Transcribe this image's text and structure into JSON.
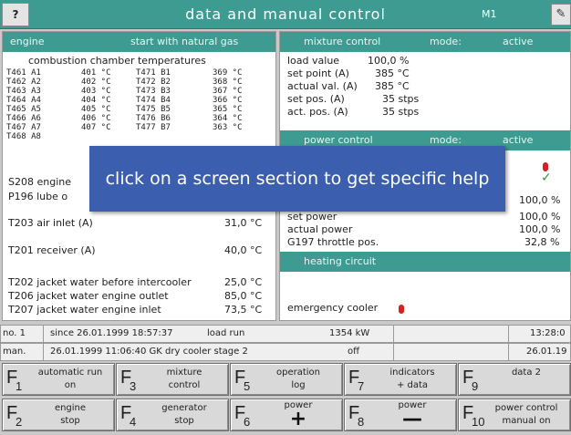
{
  "titlebar": {
    "help": "?",
    "title": "data and manual control",
    "screen_code": "M1",
    "edit_icon": "edit-icon"
  },
  "engine": {
    "header_left": "engine",
    "header_right": "start with natural gas",
    "combustion_title": "combustion chamber temperatures",
    "temps": [
      {
        "tag": "T461 A1",
        "val": "401 °C",
        "tag2": "T471 B1",
        "val2": "369 °C"
      },
      {
        "tag": "T462 A2",
        "val": "402 °C",
        "tag2": "T472 B2",
        "val2": "368 °C"
      },
      {
        "tag": "T463 A3",
        "val": "403 °C",
        "tag2": "T473 B3",
        "val2": "367 °C"
      },
      {
        "tag": "T464 A4",
        "val": "404 °C",
        "tag2": "T474 B4",
        "val2": "366 °C"
      },
      {
        "tag": "T465 A5",
        "val": "405 °C",
        "tag2": "T475 B5",
        "val2": "365 °C"
      },
      {
        "tag": "T466 A6",
        "val": "406 °C",
        "tag2": "T476 B6",
        "val2": "364 °C"
      },
      {
        "tag": "T467 A7",
        "val": "407 °C",
        "tag2": "T477 B7",
        "val2": "363 °C"
      },
      {
        "tag": "T468 A8",
        "val": "",
        "tag2": "",
        "val2": ""
      }
    ],
    "s208": "S208 engine",
    "p196": "P196 lube o",
    "t203_label": "T203 air inlet (A)",
    "t203_val": "31,0 °C",
    "t201_label": "T201 receiver (A)",
    "t201_val": "40,0 °C",
    "t202_label": "T202 jacket water before intercooler",
    "t202_val": "25,0 °C",
    "t206_label": "T206 jacket water engine outlet",
    "t206_val": "85,0 °C",
    "t207_label": "T207 jacket water engine inlet",
    "t207_val": "73,5 °C"
  },
  "mixture": {
    "header": "mixture control",
    "mode_label": "mode:",
    "mode_value": "active",
    "rows": [
      {
        "label": "load value",
        "value": "100,0 %"
      },
      {
        "label": "set point (A)",
        "value": "385 °C"
      },
      {
        "label": "actual val. (A)",
        "value": "385 °C"
      },
      {
        "label": "set pos. (A)",
        "value": "35 stps"
      },
      {
        "label": "act. pos. (A)",
        "value": "35 stps"
      }
    ]
  },
  "power": {
    "header": "power control",
    "mode_label": "mode:",
    "mode_value": "active",
    "rows": [
      {
        "label": "",
        "value": "100,0 %"
      },
      {
        "label": "set power",
        "value": "100,0 %"
      },
      {
        "label": "actual power",
        "value": "100,0 %"
      },
      {
        "label": "G197 throttle pos.",
        "value": "32,8 %"
      }
    ]
  },
  "heating": {
    "header": "heating circuit",
    "emergency_label": "emergency cooler"
  },
  "help_overlay": {
    "text": "click on a screen section to get specific help"
  },
  "status": {
    "row1": {
      "no": "no. 1",
      "since": "since 26.01.1999  18:57:37",
      "state": "load run",
      "power": "1354 kW",
      "time": "13:28:0"
    },
    "row2": {
      "man": "man.",
      "event": "26.01.1999 11:06:40 GK dry cooler stage 2",
      "state": "off",
      "date": "26.01.19"
    }
  },
  "fkeys": [
    {
      "num": "1",
      "line1": "automatic run",
      "line2": "on"
    },
    {
      "num": "3",
      "line1": "mixture",
      "line2": "control"
    },
    {
      "num": "5",
      "line1": "operation",
      "line2": "log"
    },
    {
      "num": "7",
      "line1": "indicators",
      "line2": "+ data"
    },
    {
      "num": "9",
      "line1": "data 2",
      "line2": ""
    },
    {
      "num": "2",
      "line1": "engine",
      "line2": "stop"
    },
    {
      "num": "4",
      "line1": "generator",
      "line2": "stop"
    },
    {
      "num": "6",
      "line1": "power",
      "glyph": "+"
    },
    {
      "num": "8",
      "line1": "power",
      "glyph": "—"
    },
    {
      "num": "10",
      "line1": "power control",
      "line2": "manual on"
    }
  ],
  "fkey_letter": "F"
}
